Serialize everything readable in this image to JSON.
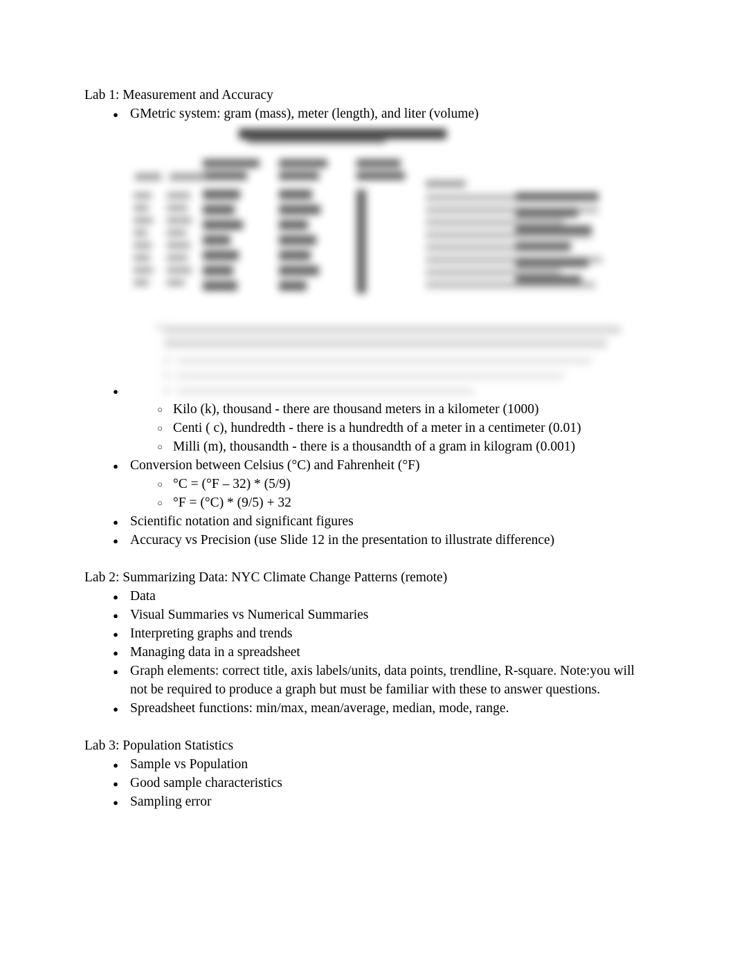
{
  "document": {
    "sections": [
      {
        "heading": "Lab 1: Measurement and Accuracy",
        "items": [
          {
            "level": 1,
            "bullet": "disc",
            "text": "GMetric system: gram (mass), meter (length), and liter (volume)"
          },
          {
            "level": 1,
            "bullet": "disc",
            "text": "",
            "note": "empty bullet containing embedded image"
          },
          {
            "level": 2,
            "bullet": "circle",
            "text": "Kilo (k), thousand - there are thousand meters in a kilometer (1000)"
          },
          {
            "level": 2,
            "bullet": "circle",
            "text": "Centi ( c), hundredth - there is a hundredth of a meter in a centimeter (0.01)"
          },
          {
            "level": 2,
            "bullet": "circle",
            "text": "Milli (m), thousandth - there is a thousandth of a gram in kilogram (0.001)"
          },
          {
            "level": 1,
            "bullet": "disc",
            "text": "Conversion between Celsius (°C) and Fahrenheit (°F)"
          },
          {
            "level": 2,
            "bullet": "circle",
            "text": "°C = (°F – 32) * (5/9)"
          },
          {
            "level": 2,
            "bullet": "circle",
            "text": "°F = (°C) * (9/5) + 32"
          },
          {
            "level": 1,
            "bullet": "disc",
            "text": "Scientific notation and significant figures"
          },
          {
            "level": 1,
            "bullet": "disc",
            "text": "Accuracy vs Precision (use Slide 12 in the presentation to illustrate difference)"
          }
        ]
      },
      {
        "heading": "Lab 2: Summarizing Data: NYC Climate Change Patterns (remote)",
        "items": [
          {
            "level": 1,
            "bullet": "disc",
            "text": "Data"
          },
          {
            "level": 1,
            "bullet": "disc",
            "text": "Visual Summaries vs Numerical Summaries"
          },
          {
            "level": 1,
            "bullet": "disc",
            "text": "Interpreting graphs and trends"
          },
          {
            "level": 1,
            "bullet": "disc",
            "text": "Managing data in a spreadsheet"
          },
          {
            "level": 1,
            "bullet": "disc",
            "text": "Graph elements: correct title, axis labels/units, data points, trendline, R-square. Note:you will not be required to produce a graph but must be familiar with these to answer questions."
          },
          {
            "level": 1,
            "bullet": "disc",
            "text": "Spreadsheet functions: min/max, mean/average, median, mode, range."
          }
        ]
      },
      {
        "heading": "Lab 3: Population Statistics",
        "items": [
          {
            "level": 1,
            "bullet": "disc",
            "text": "Sample vs Population"
          },
          {
            "level": 1,
            "bullet": "disc",
            "text": "Good sample characteristics"
          },
          {
            "level": 1,
            "bullet": "disc",
            "text": "Sampling error"
          }
        ]
      }
    ],
    "figure": {
      "caption": "",
      "legible": false,
      "description": "blurred embedded image of a metric system reference table (illegible)"
    }
  }
}
